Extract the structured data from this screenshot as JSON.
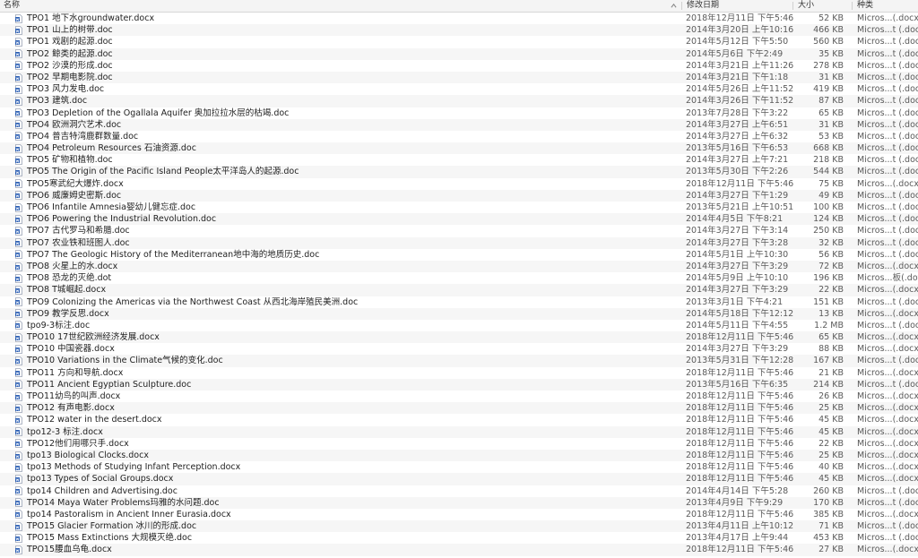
{
  "header": {
    "name": "名称",
    "date": "修改日期",
    "size": "大小",
    "kind": "种类"
  },
  "icons": {
    "sort": "chevron-up-icon",
    "file": "word-document-icon"
  },
  "files": [
    {
      "name": "TPO1 地下水groundwater.docx",
      "date": "2018年12月11日 下午5:46",
      "size": "52 KB",
      "kind": "Micros...(.docx)"
    },
    {
      "name": "TPO1 山上的树带.doc",
      "date": "2014年3月20日 上午10:16",
      "size": "466 KB",
      "kind": "Micros...t (.doc)"
    },
    {
      "name": "TPO1 戏剧的起源.doc",
      "date": "2014年5月12日 下午5:50",
      "size": "560 KB",
      "kind": "Micros...t (.doc)"
    },
    {
      "name": "TPO2 鲸类的起源.doc",
      "date": "2014年5月6日 下午2:49",
      "size": "35 KB",
      "kind": "Micros...t (.doc)"
    },
    {
      "name": "TPO2 沙漠的形成.doc",
      "date": "2014年3月21日 上午11:26",
      "size": "278 KB",
      "kind": "Micros...t (.doc)"
    },
    {
      "name": "TPO2 早期电影院.doc",
      "date": "2014年3月21日 下午1:18",
      "size": "31 KB",
      "kind": "Micros...t (.doc)"
    },
    {
      "name": "TPO3 风力发电.doc",
      "date": "2014年5月26日 上午11:52",
      "size": "419 KB",
      "kind": "Micros...t (.doc)"
    },
    {
      "name": "TPO3 建筑.doc",
      "date": "2014年3月26日 下午11:52",
      "size": "87 KB",
      "kind": "Micros...t (.doc)"
    },
    {
      "name": "TPO3 Depletion of the Ogallala Aquifer 奥加拉拉水层的枯竭.doc",
      "date": "2013年7月28日 下午3:22",
      "size": "65 KB",
      "kind": "Micros...t (.doc)"
    },
    {
      "name": "TPO4 欧洲洞穴艺术.doc",
      "date": "2014年3月27日 上午6:51",
      "size": "31 KB",
      "kind": "Micros...t (.doc)"
    },
    {
      "name": "TPO4 普吉特湾鹿群数量.doc",
      "date": "2014年3月27日 上午6:32",
      "size": "53 KB",
      "kind": "Micros...t (.doc)"
    },
    {
      "name": "TPO4 Petroleum Resources 石油资源.doc",
      "date": "2013年5月16日 下午6:53",
      "size": "668 KB",
      "kind": "Micros...t (.doc)"
    },
    {
      "name": "TPO5 矿物和植物.doc",
      "date": "2014年3月27日 上午7:21",
      "size": "218 KB",
      "kind": "Micros...t (.doc)"
    },
    {
      "name": "TPO5 The Origin of the Pacific Island People太平洋岛人的起源.doc",
      "date": "2013年5月30日 下午2:26",
      "size": "544 KB",
      "kind": "Micros...t (.doc)"
    },
    {
      "name": "TPO5寒武纪大爆炸.docx",
      "date": "2018年12月11日 下午5:46",
      "size": "75 KB",
      "kind": "Micros...(.docx)"
    },
    {
      "name": "TPO6 威廉姆史密斯.doc",
      "date": "2014年3月27日 下午1:29",
      "size": "49 KB",
      "kind": "Micros...t (.doc)"
    },
    {
      "name": "TPO6 Infantile Amnesia婴幼儿健忘症.doc",
      "date": "2013年5月21日 上午10:51",
      "size": "100 KB",
      "kind": "Micros...t (.doc)"
    },
    {
      "name": "TPO6 Powering the Industrial Revolution.doc",
      "date": "2014年4月5日 下午8:21",
      "size": "124 KB",
      "kind": "Micros...t (.doc)"
    },
    {
      "name": "TPO7 古代罗马和希腊.doc",
      "date": "2014年3月27日 下午3:14",
      "size": "250 KB",
      "kind": "Micros...t (.doc)"
    },
    {
      "name": "TPO7 农业铁和班图人.doc",
      "date": "2014年3月27日 下午3:28",
      "size": "32 KB",
      "kind": "Micros...t (.doc)"
    },
    {
      "name": "TPO7 The Geologic History of the Mediterranean地中海的地质历史.doc",
      "date": "2014年5月1日 上午10:30",
      "size": "56 KB",
      "kind": "Micros...t (.doc)"
    },
    {
      "name": "TPO8 火星上的水.docx",
      "date": "2014年3月27日 下午3:29",
      "size": "72 KB",
      "kind": "Micros...(.docx)"
    },
    {
      "name": "TPO8 恐龙的灭绝.dot",
      "date": "2014年5月9日 上午10:10",
      "size": "196 KB",
      "kind": "Micros...板(.dot)"
    },
    {
      "name": "TPO8 T城崛起.docx",
      "date": "2014年3月27日 下午3:29",
      "size": "22 KB",
      "kind": "Micros...(.docx)"
    },
    {
      "name": "TPO9  Colonizing the Americas via the Northwest Coast  从西北海岸殖民美洲.doc",
      "date": "2013年3月1日 下午4:21",
      "size": "151 KB",
      "kind": "Micros...t (.doc)"
    },
    {
      "name": "TPO9 教学反思.docx",
      "date": "2014年5月18日 下午12:12",
      "size": "13 KB",
      "kind": "Micros...(.docx)"
    },
    {
      "name": "tpo9-3标注.doc",
      "date": "2014年5月11日 下午4:55",
      "size": "1.2 MB",
      "kind": "Micros...t (.doc)"
    },
    {
      "name": "TPO10 17世纪欧洲经济发展.docx",
      "date": "2018年12月11日 下午5:46",
      "size": "65 KB",
      "kind": "Micros...(.docx)"
    },
    {
      "name": "TPO10 中国瓷器.docx",
      "date": "2014年3月27日 下午3:29",
      "size": "88 KB",
      "kind": "Micros...(.docx)"
    },
    {
      "name": "TPO10 Variations in the Climate气候的变化.doc",
      "date": "2013年5月31日 下午12:28",
      "size": "167 KB",
      "kind": "Micros...t (.doc)"
    },
    {
      "name": "TPO11 方向和导航.docx",
      "date": "2018年12月11日 下午5:46",
      "size": "21 KB",
      "kind": "Micros...(.docx)"
    },
    {
      "name": "TPO11 Ancient Egyptian Sculpture.doc",
      "date": "2013年5月16日 下午6:35",
      "size": "214 KB",
      "kind": "Micros...t (.doc)"
    },
    {
      "name": "TPO11幼鸟的叫声.docx",
      "date": "2018年12月11日 下午5:46",
      "size": "26 KB",
      "kind": "Micros...(.docx)"
    },
    {
      "name": "TPO12 有声电影.docx",
      "date": "2018年12月11日 下午5:46",
      "size": "25 KB",
      "kind": "Micros...(.docx)"
    },
    {
      "name": "TPO12 water in the desert.docx",
      "date": "2018年12月11日 下午5:46",
      "size": "45 KB",
      "kind": "Micros...(.docx)"
    },
    {
      "name": "tpo12-3 标注.docx",
      "date": "2018年12月11日 下午5:46",
      "size": "45 KB",
      "kind": "Micros...(.docx)"
    },
    {
      "name": "TPO12他们用哪只手.docx",
      "date": "2018年12月11日 下午5:46",
      "size": "22 KB",
      "kind": "Micros...(.docx)"
    },
    {
      "name": "tpo13 Biological Clocks.docx",
      "date": "2018年12月11日 下午5:46",
      "size": "25 KB",
      "kind": "Micros...(.docx)"
    },
    {
      "name": "tpo13 Methods of Studying Infant Perception.docx",
      "date": "2018年12月11日 下午5:46",
      "size": "40 KB",
      "kind": "Micros...(.docx)"
    },
    {
      "name": "tpo13 Types of Social Groups.docx",
      "date": "2018年12月11日 下午5:46",
      "size": "45 KB",
      "kind": "Micros...(.docx)"
    },
    {
      "name": "tpo14 Children and Advertising.doc",
      "date": "2014年4月14日 下午5:28",
      "size": "260 KB",
      "kind": "Micros...t (.doc)"
    },
    {
      "name": "TPO14 Maya Water Problems玛雅的水问题.doc",
      "date": "2013年4月9日 下午9:29",
      "size": "170 KB",
      "kind": "Micros...t (.doc)"
    },
    {
      "name": "tpo14 Pastoralism in Ancient Inner Eurasia.docx",
      "date": "2018年12月11日 下午5:46",
      "size": "385 KB",
      "kind": "Micros...(.docx)"
    },
    {
      "name": "TPO15 Glacier Formation 冰川的形成.doc",
      "date": "2013年4月11日 上午10:12",
      "size": "71 KB",
      "kind": "Micros...t (.doc)"
    },
    {
      "name": "TPO15 Mass Extinctions 大规模灭绝.doc",
      "date": "2013年4月17日 上午9:44",
      "size": "453 KB",
      "kind": "Micros...t (.doc)"
    },
    {
      "name": "TPO15腰血乌龟.docx",
      "date": "2018年12月11日 下午5:46",
      "size": "27 KB",
      "kind": "Micros...(.docx)"
    }
  ]
}
